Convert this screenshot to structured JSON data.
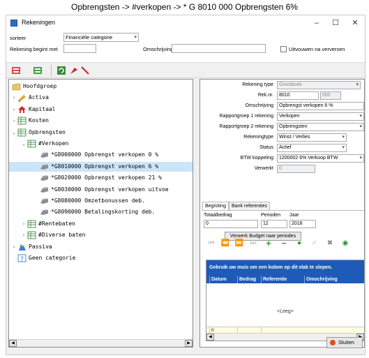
{
  "caption": "Opbrengsten -> #verkopen -> * G 8010 000 Opbrengsten 6%",
  "window": {
    "title": "Rekeningen",
    "controls": {
      "minimize": "–",
      "maximize": "☐",
      "close": "✕"
    }
  },
  "filters": {
    "sort_label": "sorteer",
    "sort_value": "Financiële categorie",
    "account_starts_label": "Rekening begint met",
    "account_starts_value": "",
    "description_label": "Omschrijving",
    "description_value": "",
    "expand_label": "Uitvouwen na verversen",
    "expand_checked": false
  },
  "toolbar": {
    "icons": [
      "collapse-icon",
      "expand-icon",
      "refresh-icon",
      "marker-icon",
      "clear-icon"
    ]
  },
  "tree": {
    "items": [
      {
        "label": "Hoofdgroep",
        "level": 0,
        "icon": "folder-icon",
        "expander": ""
      },
      {
        "label": "Activa",
        "level": 1,
        "icon": "activa-icon",
        "expander": "›"
      },
      {
        "label": "Kapitaal",
        "level": 1,
        "icon": "kapitaal-icon",
        "expander": "›"
      },
      {
        "label": "Kosten",
        "level": 1,
        "icon": "ledger-icon",
        "expander": "›"
      },
      {
        "label": "Opbrengsten",
        "level": 1,
        "icon": "ledger-icon",
        "expander": "⌄"
      },
      {
        "label": "#Verkopen",
        "level": 2,
        "icon": "ledger-icon",
        "expander": "⌄"
      },
      {
        "label": "*G8000000 Opbrengst verkopen 0 %",
        "level": 3,
        "icon": "account-icon",
        "expander": ""
      },
      {
        "label": "*G8010000 Opbrengst verkopen 6 %",
        "level": 3,
        "icon": "account-icon",
        "expander": "",
        "selected": true
      },
      {
        "label": "*G8020000 Opbrengst verkopen 21 %",
        "level": 3,
        "icon": "account-icon",
        "expander": ""
      },
      {
        "label": "*G8030000 Opbrengst verkopen uitvoe",
        "level": 3,
        "icon": "account-icon",
        "expander": ""
      },
      {
        "label": "*G8080000 Omzetbonussen deb.",
        "level": 3,
        "icon": "account-icon",
        "expander": ""
      },
      {
        "label": "*G8090000 Betalingskorting deb.",
        "level": 3,
        "icon": "account-icon",
        "expander": ""
      },
      {
        "label": "#Rentebaten",
        "level": 2,
        "icon": "ledger-icon",
        "expander": "›"
      },
      {
        "label": "#Diverse baten",
        "level": 2,
        "icon": "ledger-icon",
        "expander": "›"
      },
      {
        "label": "Passiva",
        "level": 1,
        "icon": "passiva-icon",
        "expander": "›"
      },
      {
        "label": "Geen categorie",
        "level": 1,
        "icon": "unknown-icon",
        "expander": ""
      }
    ]
  },
  "detail": {
    "rekening_type_label": "Rekening type",
    "rekening_type_value": "Grootboek",
    "rek_nr_label": "Rek.nr.",
    "rek_nr_value": "8010",
    "rek_nr_sub_value": "000",
    "omschrijving_label": "Omschrijving",
    "omschrijving_value": "Opbrengst verkopen 6 %",
    "rapportgroep1_label": "Rapportgroep 1 rekening",
    "rapportgroep1_value": "Verkopen",
    "rapportgroep2_label": "Rapportgroep 2 rekening",
    "rapportgroep2_value": "Opbrengsten",
    "rekeningtype_label": "Rekeningtype",
    "rekeningtype_value": "Winst / Verlies",
    "status_label": "Status",
    "status_value": "Actief",
    "btw_label": "BTW koppeling",
    "btw_value": "1200002 6% Verkoop BTW",
    "verwerkt_label": "Verwerkt",
    "verwerkt_value": "0"
  },
  "tabs": [
    {
      "label": "Begroting",
      "active": true
    },
    {
      "label": "Bank referenties",
      "active": false
    }
  ],
  "budget": {
    "totaalbedrag_label": "Totaalbedrag",
    "totaalbedrag_value": "0",
    "perioden_label": "Perioden",
    "perioden_value": "12",
    "jaar_label": "Jaar",
    "jaar_value": "2018",
    "process_button": "Verwerk Budget naar periodes"
  },
  "nav_buttons": [
    "first-icon",
    "prev-page-icon",
    "next-page-icon",
    "last-icon",
    "add-icon",
    "remove-icon",
    "up-icon",
    "confirm-icon",
    "cancel-icon",
    "refresh-icon"
  ],
  "grid": {
    "banner": "Gebruik uw muis om een kolom op dit vlak te slepen.",
    "columns": [
      "Datum",
      "Bedrag",
      "Referentie",
      "Omschrijving"
    ],
    "empty_text": "<Leeg>",
    "footer_values": [
      "0",
      "",
      ""
    ]
  },
  "footer": {
    "close_label": "Sluiten"
  },
  "colors": {
    "grid_header": "#1e5bb8",
    "selection": "#cce4f7",
    "close_icon": "#e2501a"
  }
}
